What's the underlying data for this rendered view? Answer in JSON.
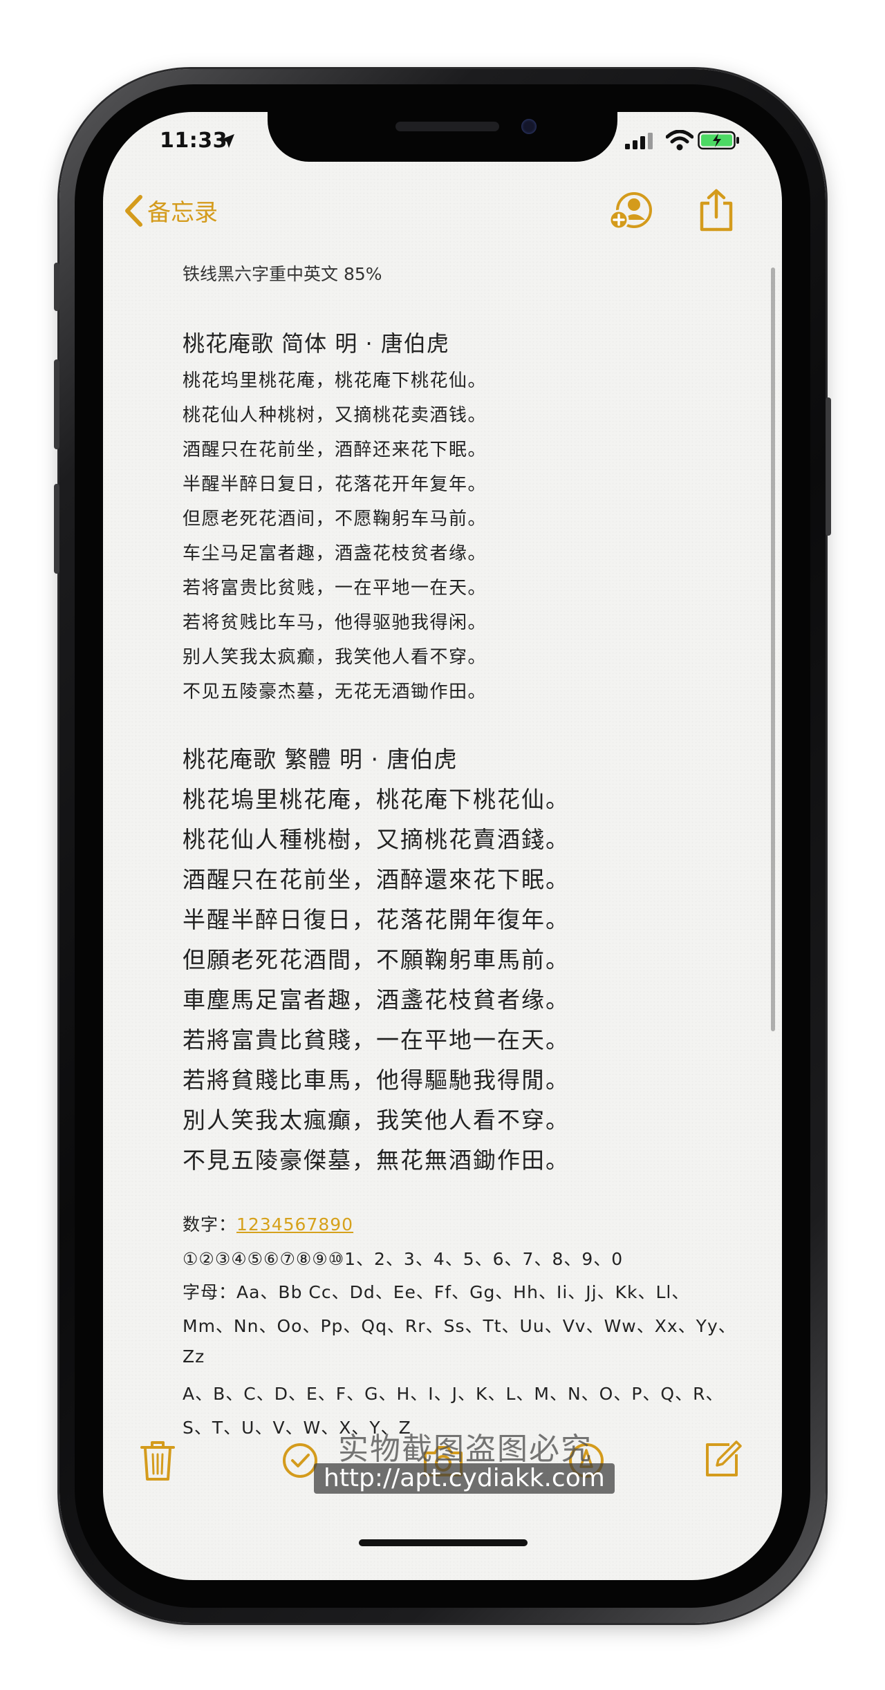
{
  "status_bar": {
    "time": "11:33"
  },
  "nav": {
    "back_label": "备忘录"
  },
  "note": {
    "subtitle": "铁线黑六字重中英文 85%",
    "simplified": {
      "heading": "桃花庵歌  简体   明 · 唐伯虎",
      "lines": [
        "桃花坞里桃花庵，桃花庵下桃花仙。",
        "桃花仙人种桃树，又摘桃花卖酒钱。",
        "酒醒只在花前坐，酒醉还来花下眠。",
        "半醒半醉日复日，花落花开年复年。",
        "但愿老死花酒间，不愿鞠躬车马前。",
        "车尘马足富者趣，酒盏花枝贫者缘。",
        "若将富贵比贫贱，一在平地一在天。",
        "若将贫贱比车马，他得驱驰我得闲。",
        "别人笑我太疯癫，我笑他人看不穿。",
        "不见五陵豪杰墓，无花无酒锄作田。"
      ]
    },
    "traditional": {
      "heading": "桃花庵歌  繁體     明 · 唐伯虎",
      "lines": [
        "桃花塢里桃花庵，桃花庵下桃花仙。",
        "桃花仙人種桃樹，又摘桃花賣酒錢。",
        "酒醒只在花前坐，酒醉還來花下眠。",
        "半醒半醉日復日，花落花開年復年。",
        "但願老死花酒間，不願鞠躬車馬前。",
        "車塵馬足富者趣，酒盞花枝貧者缘。",
        "若將富貴比貧賤，一在平地一在天。",
        "若將貧賤比車馬，他得驅馳我得閒。",
        "別人笑我太瘋癲，我笑他人看不穿。",
        "不見五陵豪傑墓，無花無酒鋤作田。"
      ]
    },
    "digits_label": "数字：",
    "digits_link": "1234567890",
    "circled": "①②③④⑤⑥⑦⑧⑨⑩1、2、3、4、5、6、7、8、9、0",
    "letters_1": "字母：Aa、Bb Cc、Dd、Ee、Ff、Gg、Hh、Ii、Jj、Kk、Ll、",
    "letters_2": "Mm、Nn、Oo、Pp、Qq、Rr、Ss、Tt、Uu、Vv、Ww、Xx、Yy、",
    "letters_3": "Zz",
    "upper_1": "A、B、C、D、E、F、G、H、I、J、K、L、M、N、O、P、Q、R、",
    "upper_2": "S、T、U、V、W、X、Y、Z"
  },
  "watermark": {
    "line1": "实物截图盗图必究",
    "line2": "http://apt.cydiakk.com"
  },
  "colors": {
    "accent": "#d49b1c",
    "paper": "#f3f3f1"
  }
}
